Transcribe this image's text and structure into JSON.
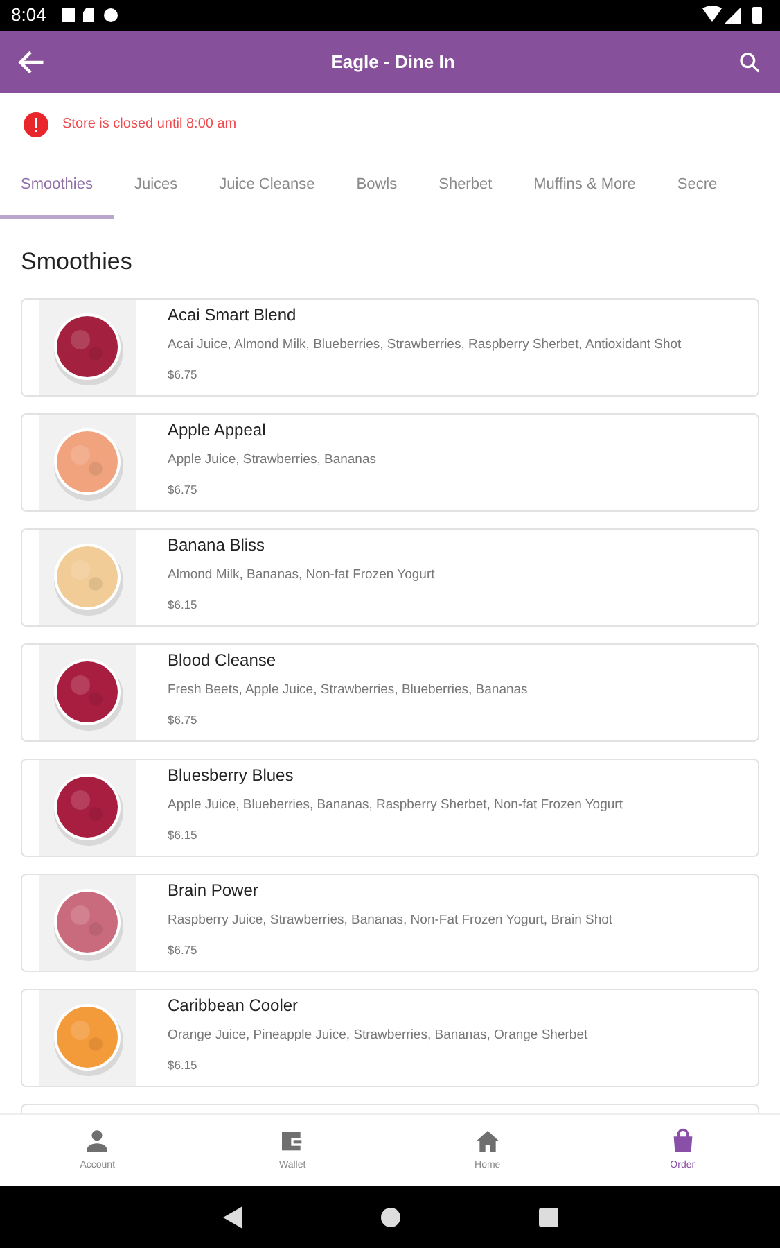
{
  "status_bar": {
    "time": "8:04"
  },
  "app_bar": {
    "title": "Eagle - Dine In"
  },
  "alert": {
    "message": "Store is closed until 8:00 am"
  },
  "tabs": [
    {
      "label": "Smoothies",
      "selected": true
    },
    {
      "label": "Juices",
      "selected": false
    },
    {
      "label": "Juice Cleanse",
      "selected": false
    },
    {
      "label": "Bowls",
      "selected": false
    },
    {
      "label": "Sherbet",
      "selected": false
    },
    {
      "label": "Muffins & More",
      "selected": false
    },
    {
      "label": "Secre",
      "selected": false
    }
  ],
  "section_title": "Smoothies",
  "items": [
    {
      "name": "Acai Smart Blend",
      "ingredients": "Acai Juice, Almond Milk, Blueberries, Strawberries, Raspberry Sherbet, Antioxidant Shot",
      "price": "$6.75"
    },
    {
      "name": "Apple Appeal",
      "ingredients": "Apple Juice, Strawberries, Bananas",
      "price": "$6.75"
    },
    {
      "name": "Banana Bliss",
      "ingredients": "Almond Milk, Bananas, Non-fat Frozen Yogurt",
      "price": "$6.15"
    },
    {
      "name": "Blood Cleanse",
      "ingredients": "Fresh Beets, Apple Juice, Strawberries, Blueberries, Bananas",
      "price": "$6.75"
    },
    {
      "name": "Bluesberry Blues",
      "ingredients": "Apple Juice, Blueberries, Bananas, Raspberry Sherbet, Non-fat Frozen Yogurt",
      "price": "$6.15"
    },
    {
      "name": "Brain Power",
      "ingredients": "Raspberry Juice, Strawberries, Bananas, Non-Fat Frozen Yogurt, Brain Shot",
      "price": "$6.75"
    },
    {
      "name": "Caribbean Cooler",
      "ingredients": "Orange Juice, Pineapple Juice, Strawberries, Bananas, Orange Sherbet",
      "price": "$6.15"
    }
  ],
  "bottom_nav": [
    {
      "label": "Account",
      "selected": false,
      "kind": "person"
    },
    {
      "label": "Wallet",
      "selected": false,
      "kind": "wallet"
    },
    {
      "label": "Home",
      "selected": false,
      "kind": "home"
    },
    {
      "label": "Order",
      "selected": true,
      "kind": "bag"
    }
  ]
}
